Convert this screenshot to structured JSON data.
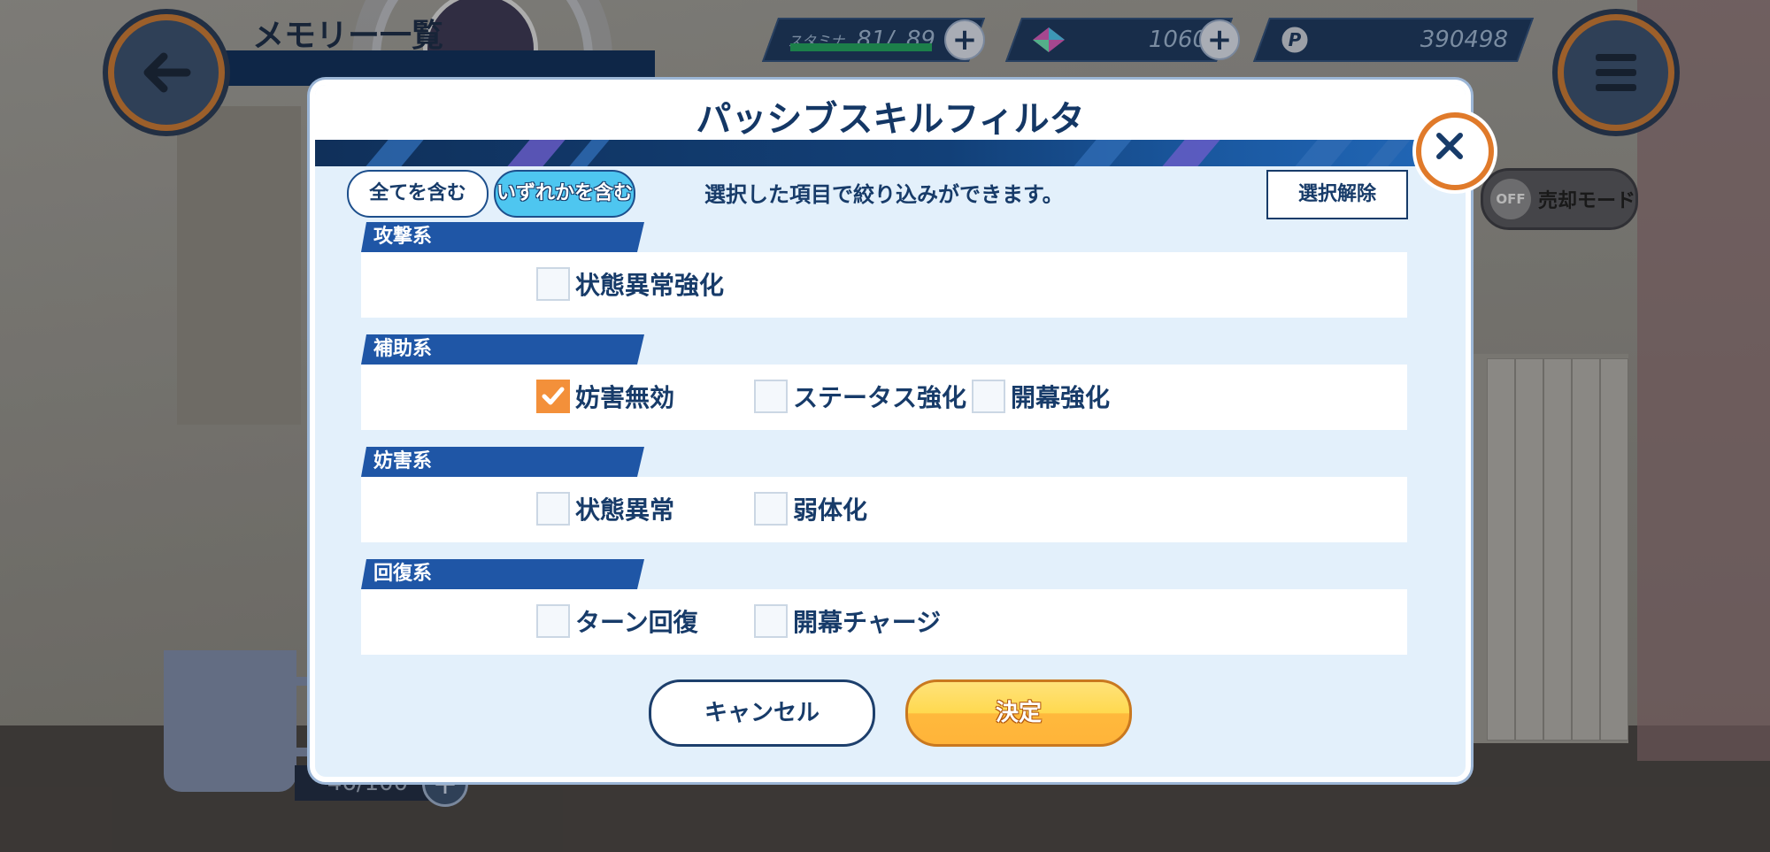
{
  "screen": {
    "title": "メモリー一覧",
    "stamina": {
      "label": "スタミナ",
      "current": "81/",
      "max": "89"
    },
    "gems": "1060",
    "coins": "390498",
    "sell_mode": {
      "state": "OFF",
      "label": "売却モード"
    },
    "inventory_count": "46/100"
  },
  "dialog": {
    "title": "パッシブスキルフィルタ",
    "mode_all_label": "全てを含む",
    "mode_any_label": "いずれかを含む",
    "selected_mode": "いずれかを含む",
    "hint": "選択した項目で絞り込みができます。",
    "clear_label": "選択解除",
    "categories": [
      {
        "label": "攻撃系",
        "options": [
          {
            "label": "状態異常強化",
            "checked": false
          }
        ]
      },
      {
        "label": "補助系",
        "options": [
          {
            "label": "妨害無効",
            "checked": true
          },
          {
            "label": "ステータス強化",
            "checked": false
          },
          {
            "label": "開幕強化",
            "checked": false
          }
        ]
      },
      {
        "label": "妨害系",
        "options": [
          {
            "label": "状態異常",
            "checked": false
          },
          {
            "label": "弱体化",
            "checked": false
          }
        ]
      },
      {
        "label": "回復系",
        "options": [
          {
            "label": "ターン回復",
            "checked": false
          },
          {
            "label": "開幕チャージ",
            "checked": false
          }
        ]
      }
    ],
    "cancel_label": "キャンセル",
    "confirm_label": "決定"
  },
  "colors": {
    "accent_orange": "#f3903a",
    "navy": "#173b69",
    "selected_mode": "#4ec6f0",
    "confirm_yellow": "#ffd94f"
  }
}
